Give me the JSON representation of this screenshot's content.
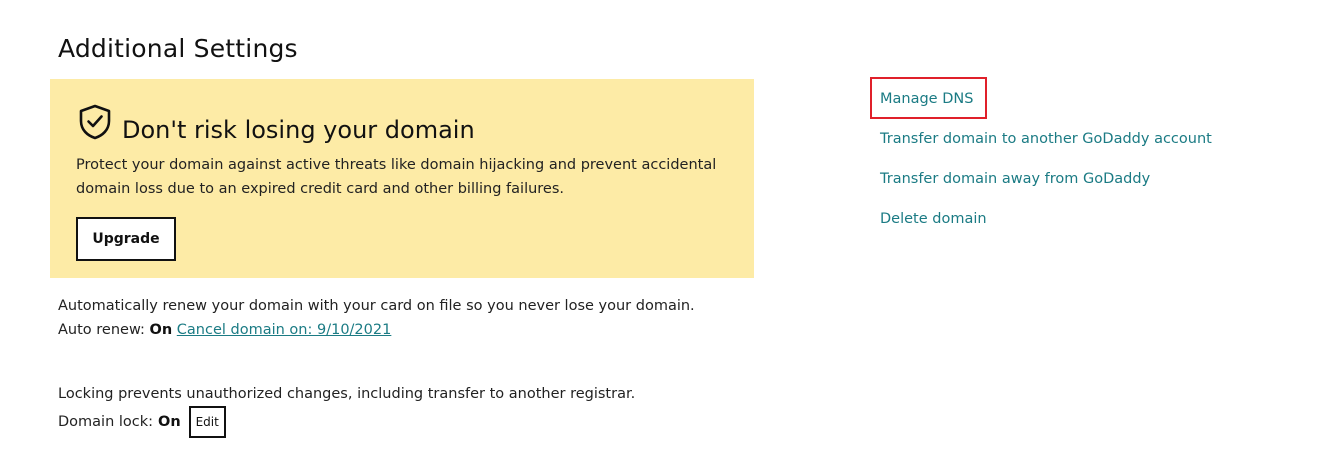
{
  "section": {
    "title": "Additional Settings"
  },
  "promo": {
    "icon": "shield-check-icon",
    "title": "Don't risk losing your domain",
    "description": "Protect your domain against active threats like domain hijacking and prevent accidental domain loss due to an expired credit card and other billing failures.",
    "upgrade_label": "Upgrade",
    "background_color": "#fdeba6"
  },
  "auto_renew": {
    "description": "Automatically renew your domain with your card on file so you never lose your domain.",
    "label": "Auto renew:",
    "value": "On",
    "cancel_link": "Cancel domain on: 9/10/2021"
  },
  "domain_lock": {
    "description": "Locking prevents unauthorized changes, including transfer to another registrar.",
    "label": "Domain lock:",
    "value": "On",
    "edit_label": "Edit"
  },
  "actions": [
    {
      "label": "Manage DNS",
      "highlighted": true
    },
    {
      "label": "Transfer domain to another GoDaddy account"
    },
    {
      "label": "Transfer domain away from GoDaddy"
    },
    {
      "label": "Delete domain"
    }
  ],
  "colors": {
    "link": "#1b7b84",
    "highlight": "#e0202a"
  }
}
